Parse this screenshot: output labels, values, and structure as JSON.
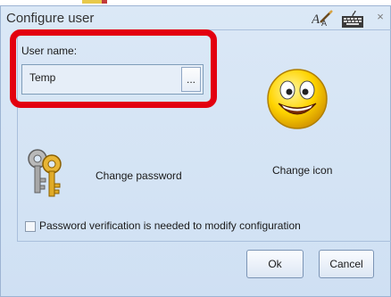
{
  "window": {
    "title": "Configure user",
    "icons": [
      "spellcheck-icon",
      "keyboard-icon"
    ],
    "close_glyph": "×"
  },
  "user": {
    "label": "User name:",
    "value": "Temp",
    "browse_label": "..."
  },
  "actions": {
    "change_password": "Change password",
    "change_icon": "Change icon"
  },
  "options": {
    "password_verification_label": "Password verification is needed to modify configuration",
    "password_verification_checked": false
  },
  "buttons": {
    "ok": "Ok",
    "cancel": "Cancel"
  },
  "colors": {
    "highlight": "#e3000f",
    "dialog_bg": "#dbe8f6"
  }
}
